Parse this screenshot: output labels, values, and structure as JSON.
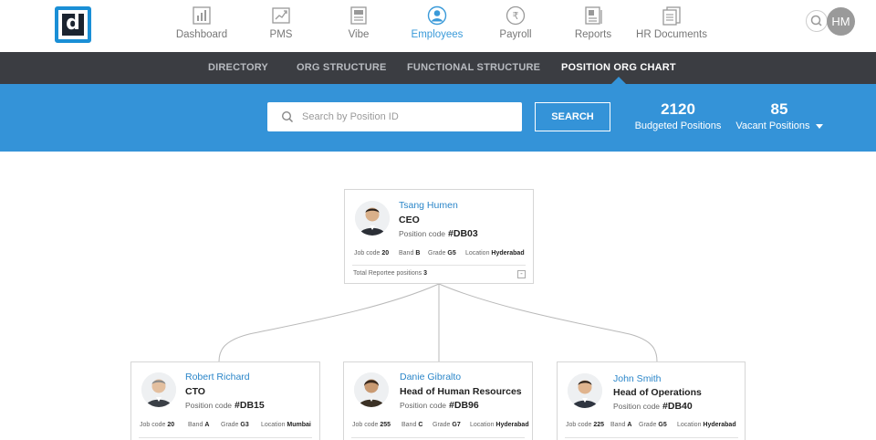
{
  "logo": {
    "letter": "d"
  },
  "nav": {
    "items": [
      {
        "label": "Dashboard",
        "icon": "bar-chart-icon"
      },
      {
        "label": "PMS",
        "icon": "growth-chart-icon"
      },
      {
        "label": "Vibe",
        "icon": "newspaper-icon"
      },
      {
        "label": "Employees",
        "icon": "person-icon",
        "active": true
      },
      {
        "label": "Payroll",
        "icon": "rupee-icon"
      },
      {
        "label": "Reports",
        "icon": "report-icon"
      },
      {
        "label": "HR Documents",
        "icon": "documents-icon"
      }
    ],
    "user_initials": "HM"
  },
  "subnav": {
    "tabs": [
      {
        "label": "DIRECTORY"
      },
      {
        "label": "ORG STRUCTURE"
      },
      {
        "label": "FUNCTIONAL STRUCTURE"
      },
      {
        "label": "POSITION ORG CHART",
        "active": true
      }
    ]
  },
  "search": {
    "placeholder": "Search by Position ID",
    "button_label": "SEARCH"
  },
  "stats": {
    "budgeted": {
      "value": "2120",
      "label": "Budgeted Positions"
    },
    "vacant": {
      "value": "85",
      "label": "Vacant Positions"
    }
  },
  "labels": {
    "position_code": "Position code",
    "job_code": "Job code",
    "band": "Band",
    "grade": "Grade",
    "location": "Location",
    "total_reportee": "Total Reportee positions",
    "collapse": "-"
  },
  "root": {
    "name": "Tsang Humen",
    "title": "CEO",
    "code": "#DB03",
    "job_code": "20",
    "band": "B",
    "grade": "G5",
    "location": "Hyderabad",
    "reportees": "3"
  },
  "children": [
    {
      "name": "Robert Richard",
      "title": "CTO",
      "code": "#DB15",
      "job_code": "20",
      "band": "A",
      "grade": "G3",
      "location": "Mumbai"
    },
    {
      "name": "Danie Gibralto",
      "title": "Head of Human Resources",
      "code": "#DB96",
      "job_code": "255",
      "band": "C",
      "grade": "G7",
      "location": "Hyderabad"
    },
    {
      "name": "John Smith",
      "title": "Head of Operations",
      "code": "#DB40",
      "job_code": "225",
      "band": "A",
      "grade": "G5",
      "location": "Hyderabad"
    }
  ],
  "colors": {
    "accent": "#3493d8",
    "subnav_bg": "#3b3d42",
    "link": "#2b86c9"
  }
}
